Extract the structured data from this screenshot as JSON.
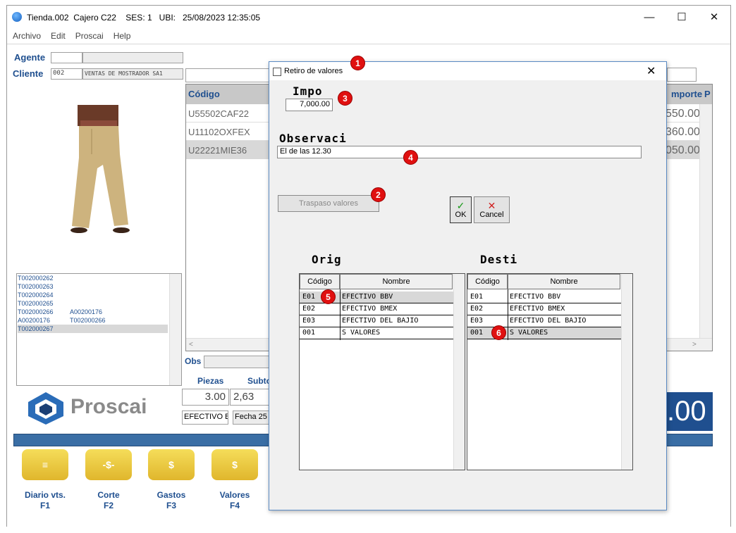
{
  "window": {
    "title": "Tienda.002  Cajero C22    SES: 1   UBI:   25/08/2023 12:35:05",
    "minimize": "—",
    "maximize": "☐",
    "close": "✕"
  },
  "menu": [
    "Archivo",
    "Edit",
    "Proscai",
    "Help"
  ],
  "header": {
    "agent_label": "Agente",
    "client_label": "Cliente",
    "client_code": "002",
    "client_name": "VENTAS DE MOSTRADOR SA1"
  },
  "grid": {
    "col_code": "Código",
    "col_importe": "mporte",
    "col_p": "P",
    "rows": [
      {
        "code": "U55502CAF22",
        "importe": "550.00"
      },
      {
        "code": "U11102OXFEX",
        "importe": "360.00"
      },
      {
        "code": "U22221MIE36",
        "importe": "050.00"
      }
    ]
  },
  "tickets": [
    {
      "a": "T002000262",
      "b": ""
    },
    {
      "a": "T002000263",
      "b": ""
    },
    {
      "a": "T002000264",
      "b": ""
    },
    {
      "a": "T002000265",
      "b": ""
    },
    {
      "a": "T002000266",
      "b": "A00200176"
    },
    {
      "a": "A00200176",
      "b": "T002000266"
    },
    {
      "a": "T002000267",
      "b": ""
    }
  ],
  "obs_label": "Obs",
  "totals": {
    "piezas_label": "Piezas",
    "subtotal_label": "Subto",
    "piezas_value": "3.00",
    "subtotal_value": "2,63",
    "payment": "EFECTIVO B",
    "fecha": "Fecha 25",
    "big_total": ".00"
  },
  "logo_text": "Proscai",
  "footer_buttons": [
    {
      "label": "Diario vts.",
      "key": "F1",
      "glyph": "≡"
    },
    {
      "label": "Corte",
      "key": "F2",
      "glyph": "-$-"
    },
    {
      "label": "Gastos",
      "key": "F3",
      "glyph": "$"
    },
    {
      "label": "Valores",
      "key": "F4",
      "glyph": "$"
    }
  ],
  "dialog": {
    "title": "Retiro de valores",
    "close": "✕",
    "importe_label": "Impo",
    "importe_value": "7,000.00",
    "obs_label": "Observaci",
    "obs_value": "El de las 12.30",
    "traspaso_label": "Traspaso valores",
    "ok_label": "OK",
    "cancel_label": "Cancel",
    "ok_glyph": "✓",
    "cancel_glyph": "✕",
    "origin_label": "Orig",
    "dest_label": "Desti",
    "col_code": "Código",
    "col_name": "Nombre",
    "origin_rows": [
      {
        "code": "E01",
        "name": "EFECTIVO BBV"
      },
      {
        "code": "E02",
        "name": "EFECTIVO BMEX"
      },
      {
        "code": "E03",
        "name": "EFECTIVO DEL BAJIO"
      },
      {
        "code": "001",
        "name": "S VALORES"
      }
    ],
    "dest_rows": [
      {
        "code": "E01",
        "name": "EFECTIVO BBV"
      },
      {
        "code": "E02",
        "name": "EFECTIVO BMEX"
      },
      {
        "code": "E03",
        "name": "EFECTIVO DEL BAJIO"
      },
      {
        "code": "001",
        "name": "S VALORES"
      }
    ]
  },
  "badges": [
    "1",
    "2",
    "3",
    "4",
    "5",
    "6"
  ],
  "colors": {
    "accent": "#1f4f8f",
    "band": "#3a6ea5",
    "badge": "#e01010"
  }
}
